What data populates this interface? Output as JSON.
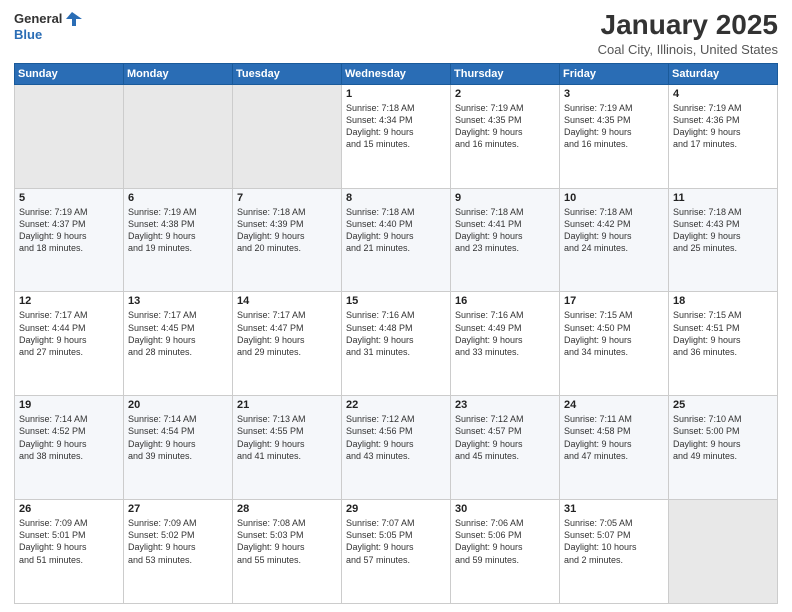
{
  "header": {
    "logo_general": "General",
    "logo_blue": "Blue",
    "title": "January 2025",
    "subtitle": "Coal City, Illinois, United States"
  },
  "weekdays": [
    "Sunday",
    "Monday",
    "Tuesday",
    "Wednesday",
    "Thursday",
    "Friday",
    "Saturday"
  ],
  "weeks": [
    [
      {
        "day": "",
        "info": ""
      },
      {
        "day": "",
        "info": ""
      },
      {
        "day": "",
        "info": ""
      },
      {
        "day": "1",
        "info": "Sunrise: 7:18 AM\nSunset: 4:34 PM\nDaylight: 9 hours\nand 15 minutes."
      },
      {
        "day": "2",
        "info": "Sunrise: 7:19 AM\nSunset: 4:35 PM\nDaylight: 9 hours\nand 16 minutes."
      },
      {
        "day": "3",
        "info": "Sunrise: 7:19 AM\nSunset: 4:35 PM\nDaylight: 9 hours\nand 16 minutes."
      },
      {
        "day": "4",
        "info": "Sunrise: 7:19 AM\nSunset: 4:36 PM\nDaylight: 9 hours\nand 17 minutes."
      }
    ],
    [
      {
        "day": "5",
        "info": "Sunrise: 7:19 AM\nSunset: 4:37 PM\nDaylight: 9 hours\nand 18 minutes."
      },
      {
        "day": "6",
        "info": "Sunrise: 7:19 AM\nSunset: 4:38 PM\nDaylight: 9 hours\nand 19 minutes."
      },
      {
        "day": "7",
        "info": "Sunrise: 7:18 AM\nSunset: 4:39 PM\nDaylight: 9 hours\nand 20 minutes."
      },
      {
        "day": "8",
        "info": "Sunrise: 7:18 AM\nSunset: 4:40 PM\nDaylight: 9 hours\nand 21 minutes."
      },
      {
        "day": "9",
        "info": "Sunrise: 7:18 AM\nSunset: 4:41 PM\nDaylight: 9 hours\nand 23 minutes."
      },
      {
        "day": "10",
        "info": "Sunrise: 7:18 AM\nSunset: 4:42 PM\nDaylight: 9 hours\nand 24 minutes."
      },
      {
        "day": "11",
        "info": "Sunrise: 7:18 AM\nSunset: 4:43 PM\nDaylight: 9 hours\nand 25 minutes."
      }
    ],
    [
      {
        "day": "12",
        "info": "Sunrise: 7:17 AM\nSunset: 4:44 PM\nDaylight: 9 hours\nand 27 minutes."
      },
      {
        "day": "13",
        "info": "Sunrise: 7:17 AM\nSunset: 4:45 PM\nDaylight: 9 hours\nand 28 minutes."
      },
      {
        "day": "14",
        "info": "Sunrise: 7:17 AM\nSunset: 4:47 PM\nDaylight: 9 hours\nand 29 minutes."
      },
      {
        "day": "15",
        "info": "Sunrise: 7:16 AM\nSunset: 4:48 PM\nDaylight: 9 hours\nand 31 minutes."
      },
      {
        "day": "16",
        "info": "Sunrise: 7:16 AM\nSunset: 4:49 PM\nDaylight: 9 hours\nand 33 minutes."
      },
      {
        "day": "17",
        "info": "Sunrise: 7:15 AM\nSunset: 4:50 PM\nDaylight: 9 hours\nand 34 minutes."
      },
      {
        "day": "18",
        "info": "Sunrise: 7:15 AM\nSunset: 4:51 PM\nDaylight: 9 hours\nand 36 minutes."
      }
    ],
    [
      {
        "day": "19",
        "info": "Sunrise: 7:14 AM\nSunset: 4:52 PM\nDaylight: 9 hours\nand 38 minutes."
      },
      {
        "day": "20",
        "info": "Sunrise: 7:14 AM\nSunset: 4:54 PM\nDaylight: 9 hours\nand 39 minutes."
      },
      {
        "day": "21",
        "info": "Sunrise: 7:13 AM\nSunset: 4:55 PM\nDaylight: 9 hours\nand 41 minutes."
      },
      {
        "day": "22",
        "info": "Sunrise: 7:12 AM\nSunset: 4:56 PM\nDaylight: 9 hours\nand 43 minutes."
      },
      {
        "day": "23",
        "info": "Sunrise: 7:12 AM\nSunset: 4:57 PM\nDaylight: 9 hours\nand 45 minutes."
      },
      {
        "day": "24",
        "info": "Sunrise: 7:11 AM\nSunset: 4:58 PM\nDaylight: 9 hours\nand 47 minutes."
      },
      {
        "day": "25",
        "info": "Sunrise: 7:10 AM\nSunset: 5:00 PM\nDaylight: 9 hours\nand 49 minutes."
      }
    ],
    [
      {
        "day": "26",
        "info": "Sunrise: 7:09 AM\nSunset: 5:01 PM\nDaylight: 9 hours\nand 51 minutes."
      },
      {
        "day": "27",
        "info": "Sunrise: 7:09 AM\nSunset: 5:02 PM\nDaylight: 9 hours\nand 53 minutes."
      },
      {
        "day": "28",
        "info": "Sunrise: 7:08 AM\nSunset: 5:03 PM\nDaylight: 9 hours\nand 55 minutes."
      },
      {
        "day": "29",
        "info": "Sunrise: 7:07 AM\nSunset: 5:05 PM\nDaylight: 9 hours\nand 57 minutes."
      },
      {
        "day": "30",
        "info": "Sunrise: 7:06 AM\nSunset: 5:06 PM\nDaylight: 9 hours\nand 59 minutes."
      },
      {
        "day": "31",
        "info": "Sunrise: 7:05 AM\nSunset: 5:07 PM\nDaylight: 10 hours\nand 2 minutes."
      },
      {
        "day": "",
        "info": ""
      }
    ]
  ]
}
